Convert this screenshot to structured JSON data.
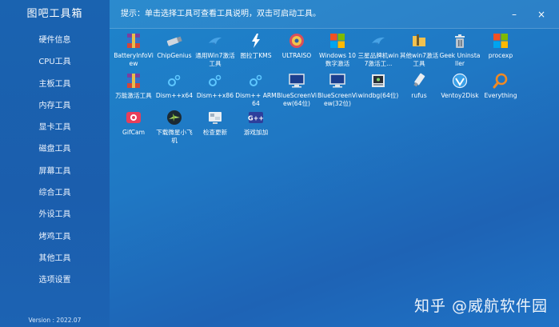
{
  "app": {
    "title": "图吧工具箱",
    "version": "Version : 2022.07"
  },
  "sidebar": {
    "items": [
      {
        "label": "硬件信息"
      },
      {
        "label": "CPU工具"
      },
      {
        "label": "主板工具"
      },
      {
        "label": "内存工具"
      },
      {
        "label": "显卡工具"
      },
      {
        "label": "磁盘工具"
      },
      {
        "label": "屏幕工具"
      },
      {
        "label": "综合工具"
      },
      {
        "label": "外设工具"
      },
      {
        "label": "烤鸡工具"
      },
      {
        "label": "其他工具"
      },
      {
        "label": "选项设置"
      }
    ]
  },
  "header": {
    "hint": "提示：单击选择工具可查看工具说明，双击可启动工具。",
    "minimize": "–",
    "close": "×"
  },
  "tools": [
    {
      "label": "BatteryInfoView",
      "icon": "winrar-icon"
    },
    {
      "label": "ChipGenius",
      "icon": "usb-drive-icon"
    },
    {
      "label": "通用Win7激活工具",
      "icon": "bird-icon"
    },
    {
      "label": "图拉丁KMS",
      "icon": "kms-icon"
    },
    {
      "label": "ULTRAISO",
      "icon": "disc-icon"
    },
    {
      "label": "Windows 10 数字激活",
      "icon": "windows-logo-icon"
    },
    {
      "label": "三星品牌机win7激活工...",
      "icon": "bird-icon"
    },
    {
      "label": "其他win7激活工具",
      "icon": "folder-icon"
    },
    {
      "label": "Geek Uninstaller",
      "icon": "trash-can-icon"
    },
    {
      "label": "procexp",
      "icon": "windows-logo-icon"
    },
    {
      "label": "万能激活工具",
      "icon": "winrar-icon"
    },
    {
      "label": "Dism++x64",
      "icon": "dism-icon"
    },
    {
      "label": "Dism++x86",
      "icon": "dism-icon"
    },
    {
      "label": "Dism++ ARM64",
      "icon": "dism-icon"
    },
    {
      "label": "BlueScreenView(64位)",
      "icon": "monitor-icon"
    },
    {
      "label": "BlueScreenView(32位)",
      "icon": "monitor-icon"
    },
    {
      "label": "windbg(64位)",
      "icon": "debugger-icon"
    },
    {
      "label": "rufus",
      "icon": "usb-stick-icon"
    },
    {
      "label": "Ventoy2Disk",
      "icon": "ventoy-icon"
    },
    {
      "label": "Everything",
      "icon": "magnifier-icon"
    },
    {
      "label": "GifCam",
      "icon": "camera-icon"
    },
    {
      "label": "下载微星小飞机",
      "icon": "afterburner-icon"
    },
    {
      "label": "检查更新",
      "icon": "update-icon"
    },
    {
      "label": "游戏加加",
      "icon": "gamepp-icon"
    }
  ],
  "watermark": "知乎 @威航软件园"
}
